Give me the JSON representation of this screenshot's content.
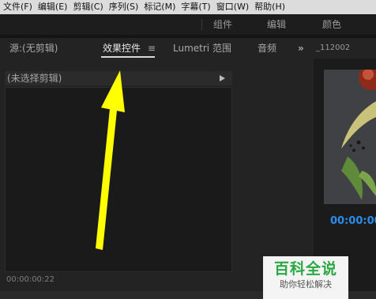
{
  "menu": [
    "文件(F)",
    "编辑(E)",
    "剪辑(C)",
    "序列(S)",
    "标记(M)",
    "字幕(T)",
    "窗口(W)",
    "帮助(H)"
  ],
  "workspaces": [
    "组件",
    "编辑",
    "颜色"
  ],
  "source_panel": {
    "tabs": [
      "源:(无剪辑)",
      "效果控件",
      "Lumetri 范围",
      "音频"
    ],
    "active_tab": "效果控件",
    "menu_glyph": "≡",
    "overflow_glyph": "»",
    "no_clip_label": "(未选择剪辑)",
    "timecode": "00:00:00:22"
  },
  "program_panel": {
    "name_fragment": "_112002",
    "timecode": "00:00:00"
  },
  "watermark": {
    "title": "百科全说",
    "subtitle": "助你轻松解决"
  },
  "colors": {
    "annotation_arrow": "#ffff00",
    "timecode_blue": "#2d8ceb",
    "watermark_green": "#2aa843"
  }
}
